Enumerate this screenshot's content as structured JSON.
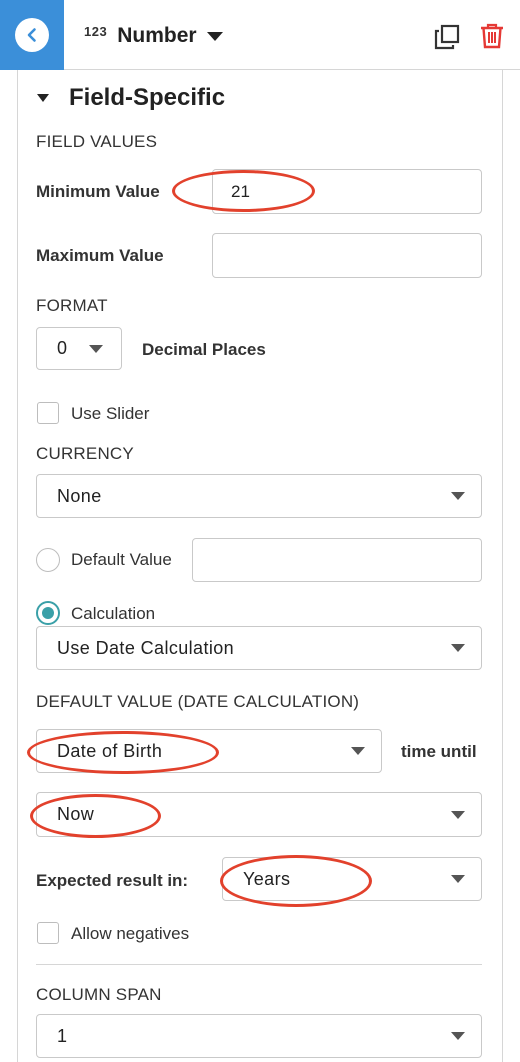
{
  "header": {
    "field_type_icon": "123",
    "field_type_label": "Number",
    "icons": {
      "back": "chevron-left-icon",
      "copy": "duplicate-icon",
      "delete": "trash-icon"
    },
    "colors": {
      "back_bg": "#3b8fd9",
      "delete": "#e53935"
    }
  },
  "section": {
    "title": "Field-Specific"
  },
  "field_values": {
    "heading": "FIELD VALUES",
    "min_label": "Minimum Value",
    "min_value": "21",
    "max_label": "Maximum Value",
    "max_value": ""
  },
  "format": {
    "heading": "FORMAT",
    "decimal_value": "0",
    "decimal_label": "Decimal Places",
    "use_slider_label": "Use Slider",
    "use_slider_checked": false
  },
  "currency": {
    "heading": "CURRENCY",
    "value": "None"
  },
  "default": {
    "default_value_label": "Default Value",
    "default_value": "",
    "calculation_label": "Calculation",
    "calculation_selected": true,
    "calculation_type": "Use Date Calculation"
  },
  "date_calc": {
    "heading": "DEFAULT VALUE (DATE CALCULATION)",
    "from_value": "Date of Birth",
    "time_until_label": "time until",
    "to_value": "Now",
    "expected_label": "Expected result in:",
    "unit_value": "Years",
    "allow_negatives_label": "Allow negatives",
    "allow_negatives_checked": false
  },
  "column_span": {
    "heading": "COLUMN SPAN",
    "value": "1"
  },
  "annotation_color": "#e2412c"
}
